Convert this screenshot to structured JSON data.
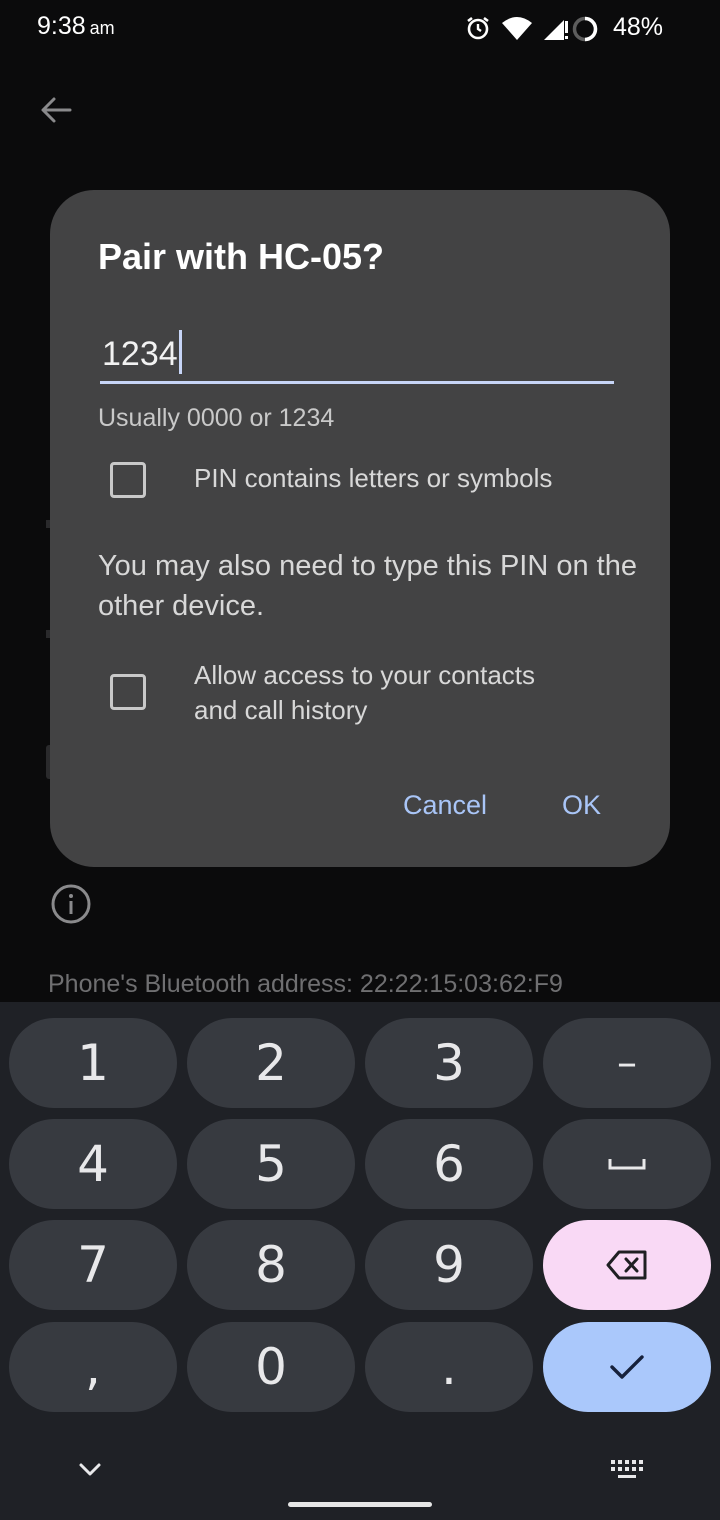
{
  "status_bar": {
    "time": "9:38",
    "ampm": "am",
    "battery_percent": "48%",
    "icons": [
      "alarm-icon",
      "wifi-icon",
      "signal-icon",
      "battery-icon"
    ]
  },
  "background": {
    "bluetooth_address": "Phone's Bluetooth address: 22:22:15:03:62:F9"
  },
  "dialog": {
    "title": "Pair with HC-05?",
    "pin_value": "1234",
    "helper": "Usually 0000 or 1234",
    "pin_letters_label": "PIN contains letters or symbols",
    "pin_letters_checked": false,
    "note": "You may also need to type this PIN on the other device.",
    "contacts_label_line1": "Allow access to your contacts",
    "contacts_label_line2": "and call history",
    "contacts_checked": false,
    "cancel_label": "Cancel",
    "ok_label": "OK"
  },
  "keyboard": {
    "keys": {
      "k1": "1",
      "k2": "2",
      "k3": "3",
      "dash": "–",
      "k4": "4",
      "k5": "5",
      "k6": "6",
      "k7": "7",
      "k8": "8",
      "k9": "9",
      "comma": ",",
      "k0": "0",
      "period": "."
    },
    "colors": {
      "background": "#1f2126",
      "key": "#373a40",
      "delete": "#f9d9f5",
      "enter": "#aac8fb"
    }
  },
  "colors": {
    "accent": "#a9c5f7",
    "dialog": "#434344"
  }
}
